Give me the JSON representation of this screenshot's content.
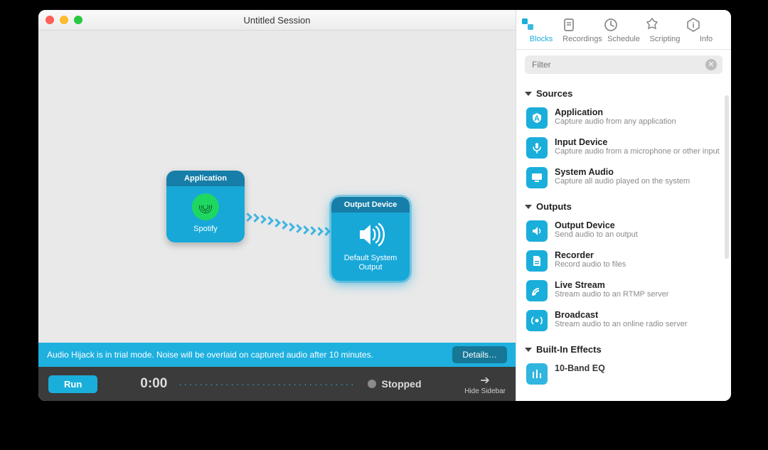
{
  "window": {
    "title": "Untitled Session"
  },
  "canvas": {
    "block1": {
      "header": "Application",
      "label": "Spotify"
    },
    "block2": {
      "header": "Output Device",
      "label": "Default System Output"
    }
  },
  "trial": {
    "message": "Audio Hijack is in trial mode. Noise will be overlaid on captured audio after 10 minutes.",
    "detailsLabel": "Details…"
  },
  "controls": {
    "runLabel": "Run",
    "time": "0:00",
    "statusLabel": "Stopped",
    "sidebarToggleLabel": "Hide Sidebar"
  },
  "sidebar": {
    "tabs": {
      "blocks": "Blocks",
      "recordings": "Recordings",
      "schedule": "Schedule",
      "scripting": "Scripting",
      "info": "Info"
    },
    "filterPlaceholder": "Filter",
    "sections": {
      "sources": {
        "title": "Sources",
        "items": [
          {
            "name": "Application",
            "desc": "Capture audio from any application"
          },
          {
            "name": "Input Device",
            "desc": "Capture audio from a microphone or other input"
          },
          {
            "name": "System Audio",
            "desc": "Capture all audio played on the system"
          }
        ]
      },
      "outputs": {
        "title": "Outputs",
        "items": [
          {
            "name": "Output Device",
            "desc": "Send audio to an output"
          },
          {
            "name": "Recorder",
            "desc": "Record audio to files"
          },
          {
            "name": "Live Stream",
            "desc": "Stream audio to an RTMP server"
          },
          {
            "name": "Broadcast",
            "desc": "Stream audio to an online radio server"
          }
        ]
      },
      "effects": {
        "title": "Built-In Effects",
        "items": [
          {
            "name": "10-Band EQ",
            "desc": ""
          }
        ]
      }
    }
  }
}
